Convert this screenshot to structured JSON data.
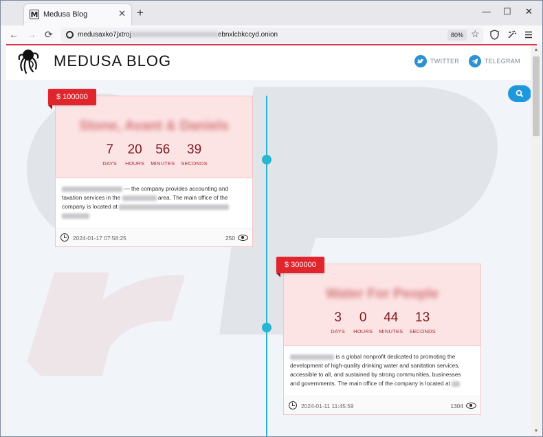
{
  "browser": {
    "tab_title": "Medusa Blog",
    "tab_favicon": "M",
    "tab_close": "✕",
    "new_tab": "+",
    "url_start": "medusaxko7jxtroj",
    "url_end": "ebnxlcbkccyd.onion",
    "zoom": "80%",
    "window_controls": {
      "minimize": "—",
      "maximize": "☐",
      "close": "✕"
    },
    "nav": {
      "back": "←",
      "forward": "→",
      "reload": "⟳"
    }
  },
  "site": {
    "title": "MEDUSA BLOG",
    "twitter_label": "TWITTER",
    "telegram_label": "TELEGRAM"
  },
  "posts": [
    {
      "price": "$ 100000",
      "company": "Stone, Avant & Daniels",
      "countdown": [
        {
          "value": "7",
          "label": "DAYS"
        },
        {
          "value": "20",
          "label": "HOURS"
        },
        {
          "value": "56",
          "label": "MINUTES"
        },
        {
          "value": "39",
          "label": "SECONDS"
        }
      ],
      "desc_a": "— the company provides accounting and",
      "desc_b": "taxation services in the",
      "desc_c": "area. The main office of the",
      "desc_d": "company is located at",
      "date": "2024-01-17 07:58:25",
      "views": "250"
    },
    {
      "price": "$ 300000",
      "company": "Water For People",
      "countdown": [
        {
          "value": "3",
          "label": "DAYS"
        },
        {
          "value": "0",
          "label": "HOURS"
        },
        {
          "value": "44",
          "label": "MINUTES"
        },
        {
          "value": "13",
          "label": "SECONDS"
        }
      ],
      "desc_a": "is a global nonprofit dedicated to promoting the",
      "desc_b": "development of high-quality drinking water and sanitation services,",
      "desc_c": "accessible to all, and sustained by strong communities, businesses",
      "desc_d": "and governments. The main office of the company is located at",
      "date": "2024-01-11 11:45:59",
      "views": "1304"
    }
  ],
  "colors": {
    "accent": "#27b5d0",
    "price_tag": "#e0252d",
    "card_top": "#fde4e4",
    "countdown": "#7e1820",
    "header_line": "#d9364a"
  },
  "icons": [
    "medusa-logo-icon",
    "twitter-icon",
    "telegram-icon",
    "search-icon",
    "clock-icon",
    "eye-icon",
    "shield-icon",
    "extensions-icon",
    "menu-icon",
    "star-icon"
  ]
}
